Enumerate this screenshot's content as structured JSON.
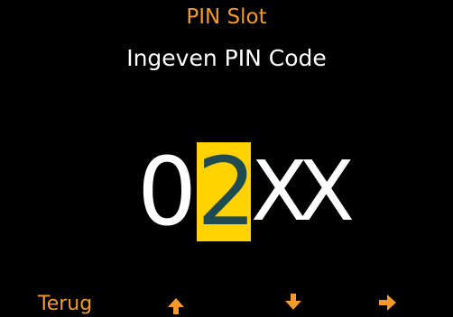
{
  "header": {
    "title": "PIN Slot",
    "subtitle": "Ingeven PIN Code"
  },
  "pin": {
    "digits": [
      "0",
      "2",
      "X",
      "X"
    ],
    "active_index": 1
  },
  "footer": {
    "back_label": "Terug",
    "up_icon": "arrow-up-icon",
    "down_icon": "arrow-down-icon",
    "right_icon": "arrow-right-icon"
  },
  "colors": {
    "accent": "#f39a2b",
    "highlight": "#ffd200",
    "active_digit": "#1f4a4f",
    "text": "#ffffff",
    "background": "#000000"
  }
}
